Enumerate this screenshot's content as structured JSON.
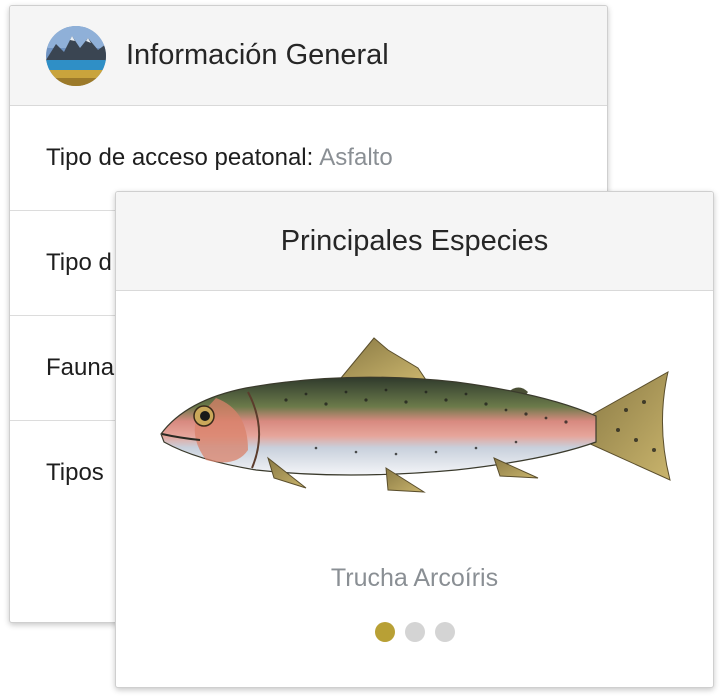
{
  "info_card": {
    "title": "Información General",
    "avatar_icon": "landscape-photo",
    "rows": [
      {
        "label": "Tipo de acceso peatonal:",
        "value": "Asfalto"
      },
      {
        "label": "Tipo d",
        "value": ""
      },
      {
        "label": "Fauna",
        "value": ""
      },
      {
        "label": "Tipos",
        "value": ""
      }
    ]
  },
  "species_card": {
    "title": "Principales Especies",
    "image_icon": "rainbow-trout-illustration",
    "species_name": "Trucha Arcoíris",
    "carousel": {
      "total": 3,
      "active": 1
    }
  },
  "colors": {
    "dot_active": "#b8a035",
    "dot_inactive": "#d4d4d4",
    "muted_text": "#8a8f94"
  }
}
